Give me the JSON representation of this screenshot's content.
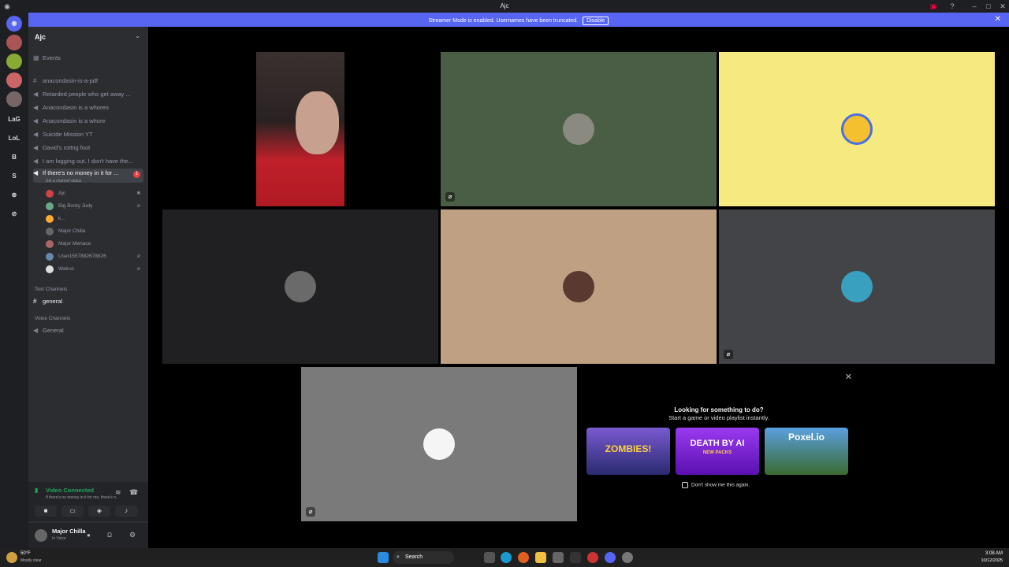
{
  "window": {
    "title": "Ajc"
  },
  "banner": {
    "message": "Streamer Mode is enabled. Usernames have been truncated.",
    "disable_label": "Disable"
  },
  "servers": [
    {
      "label": "",
      "color": "#5865f2"
    },
    {
      "label": "LaG",
      "color": "#313338"
    },
    {
      "label": "LoL",
      "color": "#313338"
    },
    {
      "label": "B",
      "color": "#313338"
    },
    {
      "label": "S",
      "color": "#313338"
    }
  ],
  "guild": {
    "name": "Ajc",
    "events_label": "Events"
  },
  "channels": [
    {
      "name": "anacondasin-is-a-pdf",
      "type": "text"
    },
    {
      "name": "Retarded people who get away ...",
      "type": "voice"
    },
    {
      "name": "Anacondasin is a whoreo",
      "type": "voice"
    },
    {
      "name": "Anacondasin is a whore",
      "type": "voice"
    },
    {
      "name": "Suicide Mission YT",
      "type": "voice"
    },
    {
      "name": "David's rottng foot",
      "type": "voice"
    },
    {
      "name": "I am logging out. I don't have the...",
      "type": "voice"
    },
    {
      "name": "If there's no money in it for ...",
      "type": "voice",
      "status": "Set a channel status",
      "badge": "1"
    }
  ],
  "members": [
    {
      "name": "Ajc",
      "color": "#c44",
      "status": "cam"
    },
    {
      "name": "Big Booty Judy",
      "color": "#6a8",
      "status": "mute"
    },
    {
      "name": "k...",
      "color": "#fa3",
      "status": ""
    },
    {
      "name": "Major Chilla",
      "color": "#666",
      "status": ""
    },
    {
      "name": "Major Menace",
      "color": "#a66",
      "status": ""
    },
    {
      "name": "User1557882678826",
      "color": "#68a",
      "status": "mute"
    },
    {
      "name": "Walrus",
      "color": "#ddd",
      "status": "mute"
    }
  ],
  "text_category": "Text Channels",
  "text_channel": "general",
  "voice_category": "Voice Channels",
  "voice_channel": "General",
  "voice_connection": {
    "status": "Video Connected",
    "channel": "If there's no money in it for me, there's n..."
  },
  "user": {
    "name": "Major Chilla",
    "status": "In Voice"
  },
  "tiles": [
    {
      "name": "ajc-video",
      "bg": "#000000"
    },
    {
      "name": "wolf",
      "bg": "#4a5e45"
    },
    {
      "name": "pikachu",
      "bg": "#f6e97f"
    },
    {
      "name": "cat",
      "bg": "#202022"
    },
    {
      "name": "screaming-man",
      "bg": "#bfa083"
    },
    {
      "name": "cartoon",
      "bg": "#434448"
    },
    {
      "name": "stick-figure",
      "bg": "#7a7a7a"
    }
  ],
  "activity": {
    "heading": "Looking for something to do?",
    "subheading": "Start a game or video playlist instantly.",
    "games": [
      {
        "name": "ZOMBIES!",
        "bg": "#4a3a90"
      },
      {
        "name": "DEATH BY AI",
        "sub": "NEW PACKS",
        "bg": "#7a1fd0"
      },
      {
        "name": "Poxel.io",
        "bg": "#3a6a30"
      }
    ],
    "dont_show": "Don't show me this again."
  },
  "taskbar": {
    "weather_temp": "50°F",
    "weather_desc": "Mostly clear",
    "search": "Search",
    "time": "3:08 AM",
    "date": "10/12/2025"
  }
}
